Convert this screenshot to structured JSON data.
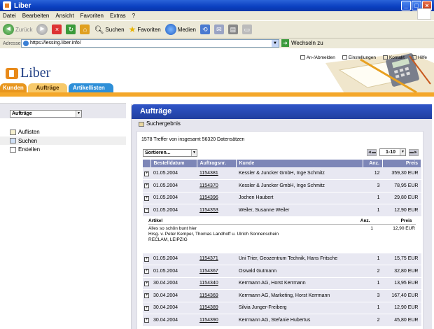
{
  "window": {
    "title": "Liber"
  },
  "menu": [
    "Datei",
    "Bearbeiten",
    "Ansicht",
    "Favoriten",
    "Extras",
    "?"
  ],
  "toolbar": {
    "back": "Zurück",
    "search": "Suchen",
    "favorites": "Favoriten",
    "media": "Medien"
  },
  "address": {
    "label": "Adresse",
    "url": "https://lessing.liber.info/",
    "go": "Wechseln zu"
  },
  "toplinks": [
    "An-/Abmelden",
    "Einstellungen",
    "Kontakt",
    "Hilfe"
  ],
  "logo": "Liber",
  "tabs": [
    "Kunden",
    "Aufträge",
    "Artikellisten"
  ],
  "sidebar": {
    "select": "Aufträge",
    "items": [
      "Auflisten",
      "Suchen",
      "Erstellen"
    ]
  },
  "main": {
    "title": "Aufträge",
    "subtitle": "Suchergebnis",
    "hits": "1578 Treffer von insgesamt  56320 Datensätzen",
    "sort": "Sortieren...",
    "page_range": "1-10",
    "columns": [
      "Bestelldatum",
      "Auftragsnr.",
      "Kunde",
      "Anz.",
      "Preis"
    ],
    "rows": [
      {
        "exp": "+",
        "date": "01.05.2004",
        "nr": "1154381",
        "kunde": "Kessler & Juncker GmbH, Inge Schmitz",
        "anz": "12",
        "preis": "359,30 EUR"
      },
      {
        "exp": "+",
        "date": "01.05.2004",
        "nr": "1154370",
        "kunde": "Kessler & Juncker GmbH, Inge Schmitz",
        "anz": "3",
        "preis": "78,95 EUR"
      },
      {
        "exp": "+",
        "date": "01.05.2004",
        "nr": "1154396",
        "kunde": "Jochen Haubert",
        "anz": "1",
        "preis": "29,80 EUR"
      },
      {
        "exp": "−",
        "date": "01.05.2004",
        "nr": "1154353",
        "kunde": "Weiler, Susanne Weiler",
        "anz": "1",
        "preis": "12,90 EUR"
      }
    ],
    "detail": {
      "columns": [
        "Artikel",
        "Anz.",
        "Preis"
      ],
      "lines": [
        "Alles so schön bunt hier",
        "Hrsg. v. Peter Kemper, Thomas Landhoff u. Ulrich Sonnenschein",
        "RECLAM, LEIPZIG"
      ],
      "anz": "1",
      "preis": "12,90 EUR"
    },
    "rows2": [
      {
        "exp": "+",
        "date": "01.05.2004",
        "nr": "1154371",
        "kunde": "Uni Trier, Geozentrum Technik, Hans Fritsche",
        "anz": "1",
        "preis": "15,75 EUR"
      },
      {
        "exp": "+",
        "date": "01.05.2004",
        "nr": "1154367",
        "kunde": "Oswald Gutmann",
        "anz": "2",
        "preis": "32,80 EUR"
      },
      {
        "exp": "+",
        "date": "30.04.2004",
        "nr": "1154340",
        "kunde": "Kerrmann AG, Horst Kerrmann",
        "anz": "1",
        "preis": "13,95 EUR"
      },
      {
        "exp": "+",
        "date": "30.04.2004",
        "nr": "1154369",
        "kunde": "Kerrmann AG, Marketing, Horst Kerrmann",
        "anz": "3",
        "preis": "167,40 EUR"
      },
      {
        "exp": "+",
        "date": "30.04.2004",
        "nr": "1154389",
        "kunde": "Silvia Junger-Freiberg",
        "anz": "1",
        "preis": "12,90 EUR"
      },
      {
        "exp": "+",
        "date": "30.04.2004",
        "nr": "1154390",
        "kunde": "Kerrmann AG, Stefanie Hubertus",
        "anz": "2",
        "preis": "45,80 EUR"
      }
    ]
  }
}
